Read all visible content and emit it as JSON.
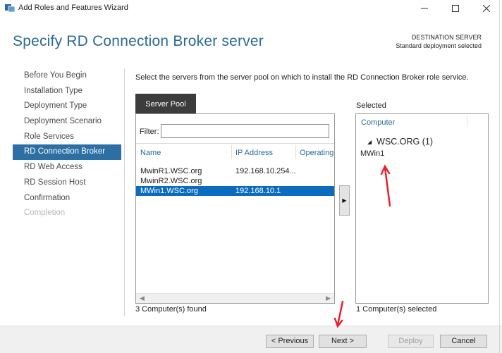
{
  "window": {
    "title": "Add Roles and Features Wizard",
    "icons": {
      "app": "server-manager-icon",
      "minimize": "minimize-icon",
      "maximize": "maximize-icon",
      "close": "close-icon"
    }
  },
  "page": {
    "heading": "Specify RD Connection Broker server",
    "destination_label": "DESTINATION SERVER",
    "destination_value": "Standard deployment selected",
    "instruction": "Select the servers from the server pool on which to install the RD Connection Broker role service."
  },
  "nav": {
    "items": [
      {
        "label": "Before You Begin",
        "state": "normal"
      },
      {
        "label": "Installation Type",
        "state": "normal"
      },
      {
        "label": "Deployment Type",
        "state": "normal"
      },
      {
        "label": "Deployment Scenario",
        "state": "normal"
      },
      {
        "label": "Role Services",
        "state": "normal"
      },
      {
        "label": "RD Connection Broker",
        "state": "active"
      },
      {
        "label": "RD Web Access",
        "state": "normal"
      },
      {
        "label": "RD Session Host",
        "state": "normal"
      },
      {
        "label": "Confirmation",
        "state": "normal"
      },
      {
        "label": "Completion",
        "state": "disabled"
      }
    ]
  },
  "server_pool": {
    "tab_label": "Server Pool",
    "filter_label": "Filter:",
    "filter_value": "",
    "columns": [
      "Name",
      "IP Address",
      "Operating"
    ],
    "rows": [
      {
        "name": "MwinR1.WSC.org",
        "ip": "192.168.10.254...",
        "selected": false
      },
      {
        "name": "MwinR2.WSC.org",
        "ip": "",
        "selected": false
      },
      {
        "name": "MWin1.WSC.org",
        "ip": "192.168.10.1",
        "selected": true
      }
    ],
    "count_text": "3 Computer(s) found"
  },
  "add_button_glyph": "▶",
  "selected_panel": {
    "label": "Selected",
    "column": "Computer",
    "group": "WSC.ORG (1)",
    "items": [
      "MWin1"
    ],
    "count_text": "1 Computer(s) selected"
  },
  "buttons": {
    "previous": "< Previous",
    "next": "Next >",
    "deploy": "Deploy",
    "cancel": "Cancel"
  },
  "colors": {
    "heading": "#2b6a94",
    "nav_active_bg": "#2c6fa4",
    "row_selected_bg": "#0a6bbf",
    "annotation_arrow": "#e8202a"
  }
}
